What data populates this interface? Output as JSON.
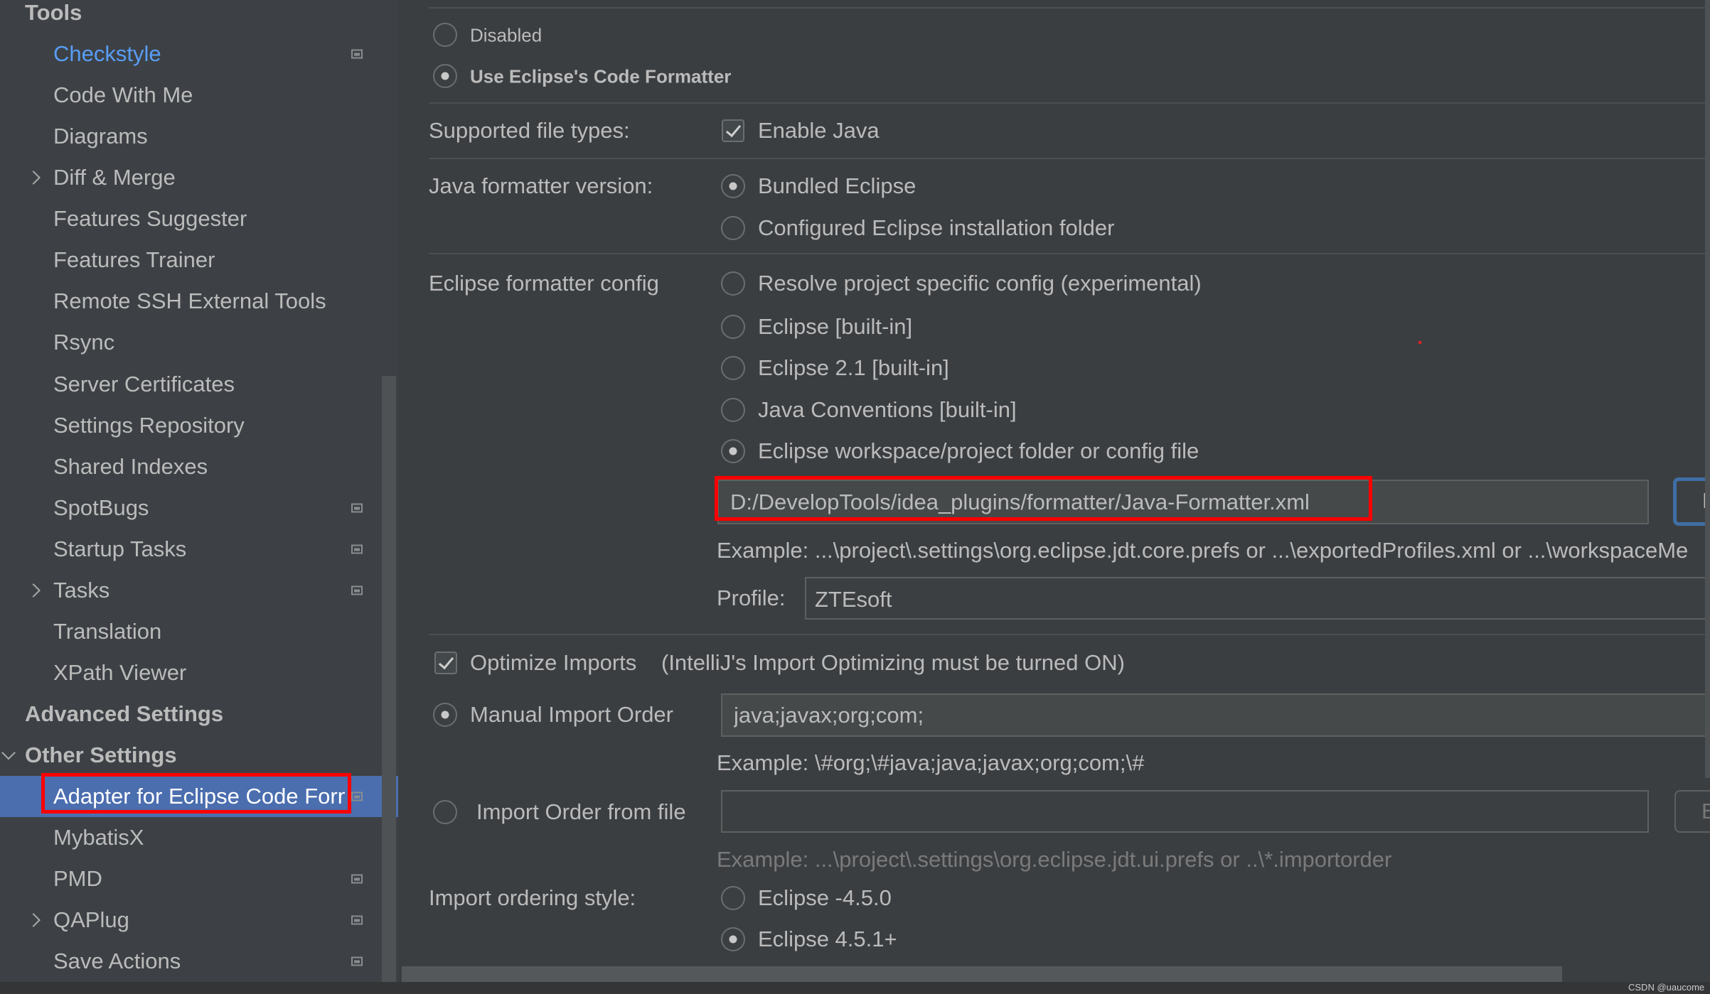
{
  "sidebar": {
    "items": [
      {
        "label": "Tools",
        "kind": "header"
      },
      {
        "label": "Checkstyle",
        "kind": "item",
        "link": true,
        "icon": true
      },
      {
        "label": "Code With Me",
        "kind": "item"
      },
      {
        "label": "Diagrams",
        "kind": "item"
      },
      {
        "label": "Diff & Merge",
        "kind": "item",
        "chevron": "right"
      },
      {
        "label": "Features Suggester",
        "kind": "item"
      },
      {
        "label": "Features Trainer",
        "kind": "item"
      },
      {
        "label": "Remote SSH External Tools",
        "kind": "item"
      },
      {
        "label": "Rsync",
        "kind": "item"
      },
      {
        "label": "Server Certificates",
        "kind": "item"
      },
      {
        "label": "Settings Repository",
        "kind": "item"
      },
      {
        "label": "Shared Indexes",
        "kind": "item"
      },
      {
        "label": "SpotBugs",
        "kind": "item",
        "icon": true
      },
      {
        "label": "Startup Tasks",
        "kind": "item",
        "icon": true
      },
      {
        "label": "Tasks",
        "kind": "item",
        "chevron": "right",
        "icon": true
      },
      {
        "label": "Translation",
        "kind": "item"
      },
      {
        "label": "XPath Viewer",
        "kind": "item"
      },
      {
        "label": "Advanced Settings",
        "kind": "bold"
      },
      {
        "label": "Other Settings",
        "kind": "bold",
        "chevron": "down"
      },
      {
        "label": "Adapter for Eclipse Code Formatter",
        "kind": "item",
        "selected": true,
        "icon": true
      },
      {
        "label": "MybatisX",
        "kind": "item"
      },
      {
        "label": "PMD",
        "kind": "item",
        "icon": true
      },
      {
        "label": "QAPlug",
        "kind": "item",
        "chevron": "right",
        "icon": true
      },
      {
        "label": "Save Actions",
        "kind": "item",
        "icon": true
      }
    ]
  },
  "main": {
    "mode_disabled": "Disabled",
    "mode_eclipse": "Use Eclipse's Code Formatter",
    "supported_label": "Supported file types:",
    "enable_java": "Enable Java",
    "version_label": "Java formatter version:",
    "version_bundled": "Bundled Eclipse",
    "version_configured": "Configured Eclipse installation folder",
    "config_label": "Eclipse formatter config",
    "config_options": [
      "Resolve project specific config (experimental)",
      "Eclipse [built-in]",
      "Eclipse 2.1 [built-in]",
      "Java Conventions [built-in]",
      "Eclipse workspace/project folder or config file"
    ],
    "config_path": "D:/DevelopTools/idea_plugins/formatter/Java-Formatter.xml",
    "browse_label": "Browse",
    "config_example": "Example: ...\\project\\.settings\\org.eclipse.jdt.core.prefs or ...\\exportedProfiles.xml or ...\\workspaceMe",
    "profile_label": "Profile:",
    "profile_value": "ZTEsoft",
    "optimize_imports": "Optimize Imports",
    "optimize_note": "(IntelliJ's Import Optimizing must be turned ON)",
    "manual_order_label": "Manual Import Order",
    "manual_order_value": "java;javax;org;com;",
    "manual_example": "Example: \\#org;\\#java;java;javax;org;com;\\#",
    "file_order_label": "Import Order from file",
    "file_order_value": "",
    "file_example": "Example: ...\\project\\.settings\\org.eclipse.jdt.ui.prefs or ..\\*.importorder",
    "ordering_style_label": "Import ordering style:",
    "ordering_old": "Eclipse -4.5.0",
    "ordering_new": "Eclipse 4.5.1+"
  },
  "watermark": "CSDN @uaucome",
  "colors": {
    "accent": "#589df6",
    "selection": "#4b6eaf",
    "highlight": "#ff0000"
  }
}
